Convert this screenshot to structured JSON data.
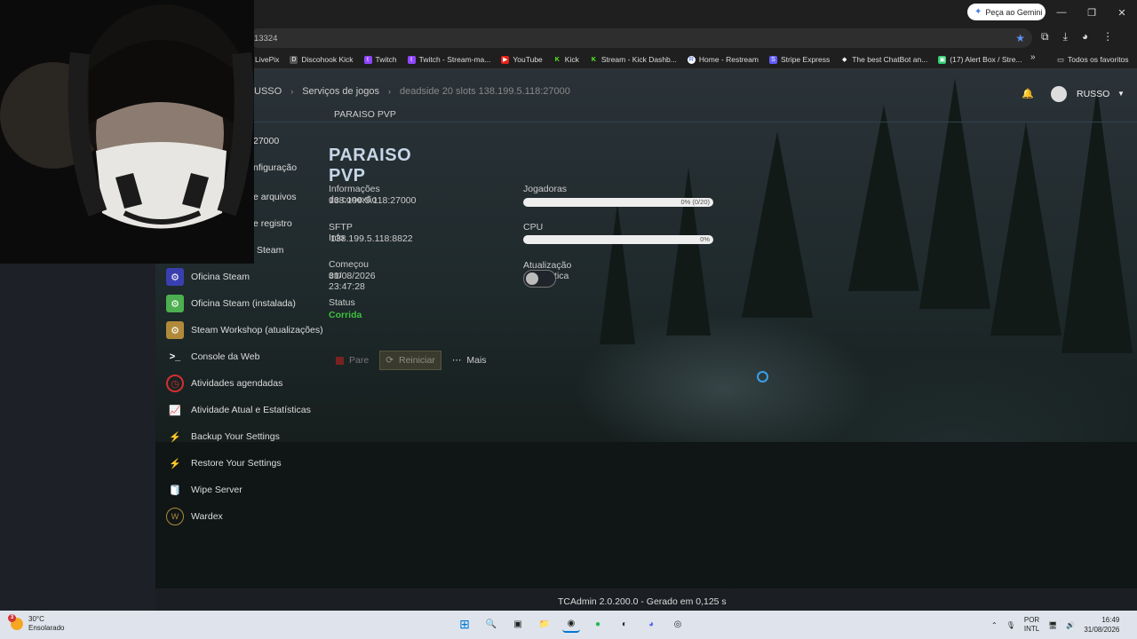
{
  "browser": {
    "gemini_label": "Peça ao Gemini",
    "url": "13324",
    "bookmarks": [
      "LivePix",
      "Discohook Kick",
      "Twitch",
      "Twitch - Stream-ma...",
      "YouTube",
      "Kick",
      "Stream - Kick Dashb...",
      "Home - Restream",
      "Stripe Express",
      "The best ChatBot an...",
      "(17) Alert Box / Stre..."
    ],
    "all_bookmarks": "Todos os favoritos"
  },
  "topnav": {
    "crumb1": "USSO",
    "crumb2": "Serviços de jogos",
    "crumb3": "deadside 20 slots 138.199.5.118:27000",
    "subtitle": "PARAISO PVP",
    "user": "RUSSO"
  },
  "sidebar": {
    "partial": [
      "27000",
      "nfiguração",
      "e arquivos",
      "e registro",
      "Steam"
    ],
    "items": [
      {
        "label": "Oficina Steam",
        "icon": "steam-workshop-icon",
        "color": "#3a3fb0"
      },
      {
        "label": "Oficina Steam (instalada)",
        "icon": "steam-workshop-installed-icon",
        "color": "#4caf50"
      },
      {
        "label": "Steam Workshop (atualizações)",
        "icon": "steam-workshop-update-icon",
        "color": "#b08a3a"
      },
      {
        "label": "Console da Web",
        "icon": "terminal-icon",
        "color": ""
      },
      {
        "label": "Atividades agendadas",
        "icon": "clock-icon",
        "color": "#d32f2f"
      },
      {
        "label": "Atividade Atual e Estatísticas",
        "icon": "chart-line-icon",
        "color": ""
      },
      {
        "label": "Backup Your Settings",
        "icon": "lightning-icon",
        "color": ""
      },
      {
        "label": "Restore Your Settings",
        "icon": "lightning-icon",
        "color": ""
      },
      {
        "label": "Wipe Server",
        "icon": "paper-roll-icon",
        "color": ""
      },
      {
        "label": "Wardex",
        "icon": "wardex-icon",
        "color": ""
      }
    ]
  },
  "server": {
    "title": "PARAISO PVP",
    "connection_label": "Informações de conexão",
    "connection_value": "138.199.5.118:27000",
    "sftp_label": "SFTP Info",
    "sftp_value": "138.199.5.118:8822",
    "started_label": "Começou em",
    "started_value": "31/08/2026 23:47:28",
    "status_label": "Status",
    "status_value": "Corrida",
    "players_label": "Jogadoras",
    "players_value": "0% (0/20)",
    "players_fraction": 0,
    "cpu_label": "CPU",
    "cpu_value": "0%",
    "cpu_fraction": 0,
    "autoupdate_label": "Atualização automática",
    "autoupdate_on": false
  },
  "actions": {
    "stop": "Pare",
    "restart": "Reiniciar",
    "more": "Mais"
  },
  "footer": "TCAdmin 2.0.200.0 - Gerado em 0,125 s",
  "taskbar": {
    "temp": "30°C",
    "weather": "Ensolarado",
    "weather_badge": "3",
    "lang1": "POR",
    "lang2": "INTL",
    "time": "16:49",
    "date": "31/08/2026"
  },
  "colors": {
    "accent_blue": "#c7d6e8",
    "status_green": "#3fc13f",
    "bell": "#e7b319"
  }
}
